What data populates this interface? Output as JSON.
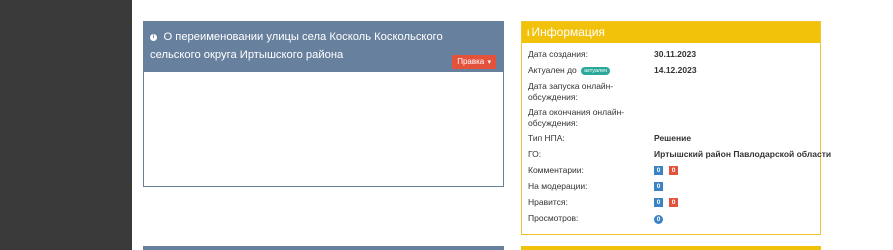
{
  "document": {
    "title": "О переименовании улицы села Косколь Коскольского сельского округа Иртышского района",
    "edit_label": "Правка"
  },
  "info": {
    "title": "Информация",
    "rows": [
      {
        "label": "Дата создания:",
        "value": "30.11.2023"
      },
      {
        "label": "Актуален до",
        "badge": "актуален",
        "value": "14.12.2023"
      },
      {
        "label": "Дата запуска онлайн-обсуждения:",
        "value": ""
      },
      {
        "label": "Дата окончания онлайн-обсуждения:",
        "value": ""
      },
      {
        "label": "Тип НПА:",
        "value": "Решение"
      },
      {
        "label": "ГО:",
        "value": "Иртышский район Павлодарской области"
      },
      {
        "label": "Комментарии:",
        "count_blue": "0",
        "count_red": "0"
      },
      {
        "label": "На модерации:",
        "count_blue": "0"
      },
      {
        "label": "Нравится:",
        "count_blue": "0",
        "count_red": "0"
      },
      {
        "label": "Просмотров:",
        "count_circle": "0"
      }
    ]
  },
  "colors": {
    "doc_header": "#67809e",
    "info_header": "#f2c10a",
    "edit_button": "#e5523b",
    "badge_blue": "#3b82c4",
    "badge_red": "#e5523b",
    "badge_green": "#2aa89a"
  }
}
